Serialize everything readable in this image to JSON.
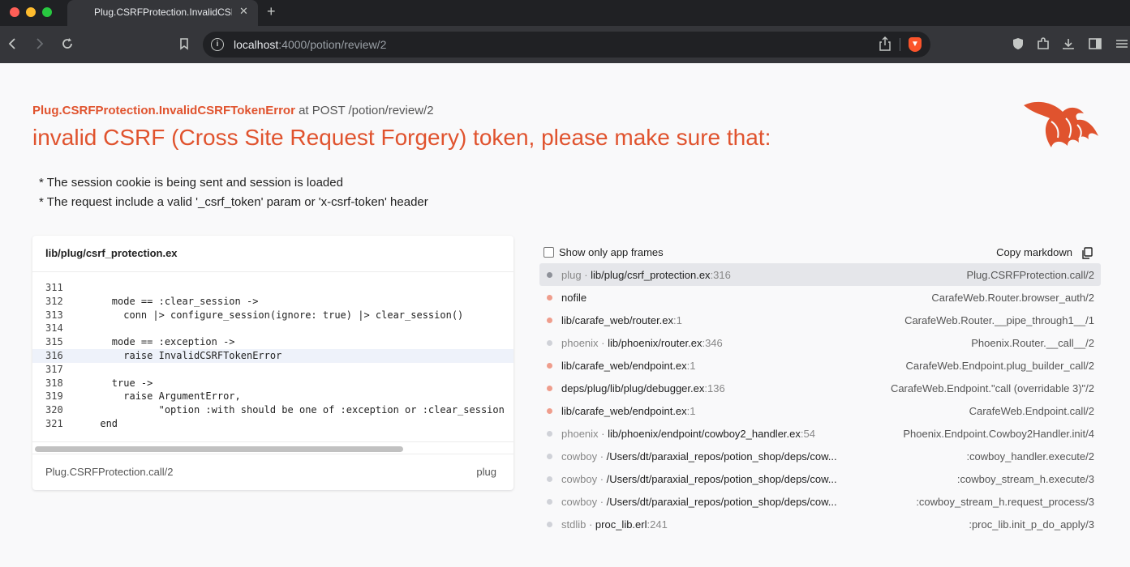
{
  "browser": {
    "tab_title": "Plug.CSRFProtection.InvalidCSRFTokenError",
    "url_host": "localhost",
    "url_rest": ":4000/potion/review/2"
  },
  "error": {
    "name": "Plug.CSRFProtection.InvalidCSRFTokenError",
    "context": " at POST /potion/review/2",
    "title": "invalid CSRF (Cross Site Request Forgery) token, please make sure that:",
    "tips": [
      "* The session cookie is being sent and session is loaded",
      "* The request include a valid '_csrf_token' param or 'x-csrf-token' header"
    ]
  },
  "code": {
    "file": "lib/plug/csrf_protection.ex",
    "highlight_line": "316",
    "lines": [
      {
        "n": "311",
        "text": ""
      },
      {
        "n": "312",
        "text": "        mode == :clear_session ->"
      },
      {
        "n": "313",
        "text": "          conn |> configure_session(ignore: true) |> clear_session()"
      },
      {
        "n": "314",
        "text": ""
      },
      {
        "n": "315",
        "text": "        mode == :exception ->"
      },
      {
        "n": "316",
        "text": "          raise InvalidCSRFTokenError"
      },
      {
        "n": "317",
        "text": ""
      },
      {
        "n": "318",
        "text": "        true ->"
      },
      {
        "n": "319",
        "text": "          raise ArgumentError,"
      },
      {
        "n": "320",
        "text": "                \"option :with should be one of :exception or :clear_session"
      },
      {
        "n": "321",
        "text": "      end"
      }
    ],
    "footer_fn": "Plug.CSRFProtection.call/2",
    "footer_app": "plug"
  },
  "frames": {
    "show_app_label": "Show only app frames",
    "copy_label": "Copy markdown",
    "items": [
      {
        "app": "plug · ",
        "file": "lib/plug/csrf_protection.ex",
        "line": ":316",
        "fn": "Plug.CSRFProtection.call/2",
        "is_app": false,
        "active": true
      },
      {
        "app": "",
        "file": "nofile",
        "line": "",
        "fn": "CarafeWeb.Router.browser_auth/2",
        "is_app": true,
        "active": false
      },
      {
        "app": "",
        "file": "lib/carafe_web/router.ex",
        "line": ":1",
        "fn": "CarafeWeb.Router.__pipe_through1__/1",
        "is_app": true,
        "active": false
      },
      {
        "app": "phoenix · ",
        "file": "lib/phoenix/router.ex",
        "line": ":346",
        "fn": "Phoenix.Router.__call__/2",
        "is_app": false,
        "active": false
      },
      {
        "app": "",
        "file": "lib/carafe_web/endpoint.ex",
        "line": ":1",
        "fn": "CarafeWeb.Endpoint.plug_builder_call/2",
        "is_app": true,
        "active": false
      },
      {
        "app": "",
        "file": "deps/plug/lib/plug/debugger.ex",
        "line": ":136",
        "fn": "CarafeWeb.Endpoint.\"call (overridable 3)\"/2",
        "is_app": true,
        "active": false
      },
      {
        "app": "",
        "file": "lib/carafe_web/endpoint.ex",
        "line": ":1",
        "fn": "CarafeWeb.Endpoint.call/2",
        "is_app": true,
        "active": false
      },
      {
        "app": "phoenix · ",
        "file": "lib/phoenix/endpoint/cowboy2_handler.ex",
        "line": ":54",
        "fn": "Phoenix.Endpoint.Cowboy2Handler.init/4",
        "is_app": false,
        "active": false
      },
      {
        "app": "cowboy · ",
        "file": "/Users/dt/paraxial_repos/potion_shop/deps/cow...",
        "line": "",
        "fn": ":cowboy_handler.execute/2",
        "is_app": false,
        "active": false
      },
      {
        "app": "cowboy · ",
        "file": "/Users/dt/paraxial_repos/potion_shop/deps/cow...",
        "line": "",
        "fn": ":cowboy_stream_h.execute/3",
        "is_app": false,
        "active": false
      },
      {
        "app": "cowboy · ",
        "file": "/Users/dt/paraxial_repos/potion_shop/deps/cow...",
        "line": "",
        "fn": ":cowboy_stream_h.request_process/3",
        "is_app": false,
        "active": false
      },
      {
        "app": "stdlib · ",
        "file": "proc_lib.erl",
        "line": ":241",
        "fn": ":proc_lib.init_p_do_apply/3",
        "is_app": false,
        "active": false
      }
    ]
  }
}
